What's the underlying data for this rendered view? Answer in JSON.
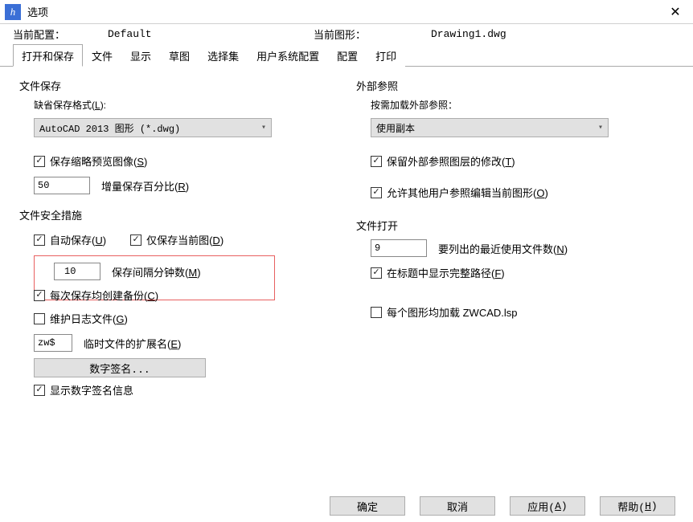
{
  "window": {
    "title": "选项"
  },
  "header": {
    "current_profile_label": "当前配置：",
    "current_profile_value": "Default",
    "current_drawing_label": "当前图形：",
    "current_drawing_value": "Drawing1.dwg"
  },
  "tabs": [
    "打开和保存",
    "文件",
    "显示",
    "草图",
    "选择集",
    "用户系统配置",
    "配置",
    "打印"
  ],
  "active_tab": 0,
  "file_save": {
    "title": "文件保存",
    "format_label_pre": "缺省保存格式(",
    "format_hotkey": "L",
    "format_label_post": "):",
    "format_value": "AutoCAD 2013 图形 (*.dwg)",
    "thumb_pre": "保存缩略预览图像(",
    "thumb_hotkey": "S",
    "thumb_post": ")",
    "thumb_checked": true,
    "incr_value": "50",
    "incr_label_pre": "增量保存百分比(",
    "incr_hotkey": "R",
    "incr_label_post": ")"
  },
  "file_safety": {
    "title": "文件安全措施",
    "autosave_pre": "自动保存(",
    "autosave_hotkey": "U",
    "autosave_post": ")",
    "autosave_checked": true,
    "only_current_pre": "仅保存当前图(",
    "only_current_hotkey": "D",
    "only_current_post": ")",
    "only_current_checked": true,
    "interval_value": "10",
    "interval_label_pre": "保存间隔分钟数(",
    "interval_hotkey": "M",
    "interval_label_post": ")",
    "backup_pre": "每次保存均创建备份(",
    "backup_hotkey": "C",
    "backup_post": ")",
    "backup_checked": true,
    "log_pre": "维护日志文件(",
    "log_hotkey": "G",
    "log_post": ")",
    "log_checked": false,
    "tmp_ext_value": "zw$",
    "tmp_ext_label_pre": "临时文件的扩展名(",
    "tmp_ext_hotkey": "E",
    "tmp_ext_label_post": ")",
    "sig_button": "数字签名...",
    "show_sig": "显示数字签名信息",
    "show_sig_checked": true
  },
  "xref": {
    "title": "外部参照",
    "demand_label": "按需加载外部参照：",
    "demand_value": "使用副本",
    "retain_pre": "保留外部参照图层的修改(",
    "retain_hotkey": "T",
    "retain_post": ")",
    "retain_checked": true,
    "allow_pre": "允许其他用户参照编辑当前图形(",
    "allow_hotkey": "O",
    "allow_post": ")",
    "allow_checked": true
  },
  "file_open": {
    "title": "文件打开",
    "recent_value": "9",
    "recent_label_pre": "要列出的最近使用文件数(",
    "recent_hotkey": "N",
    "recent_label_post": ")",
    "fullpath_pre": "在标题中显示完整路径(",
    "fullpath_hotkey": "F",
    "fullpath_post": ")",
    "fullpath_checked": true
  },
  "misc": {
    "load_lsp": "每个图形均加载 ZWCAD.lsp",
    "load_lsp_checked": false
  },
  "footer": {
    "ok": "确定",
    "cancel": "取消",
    "apply_pre": "应用(",
    "apply_hotkey": "A",
    "apply_post": ")",
    "help_pre": "帮助(",
    "help_hotkey": "H",
    "help_post": ")"
  }
}
